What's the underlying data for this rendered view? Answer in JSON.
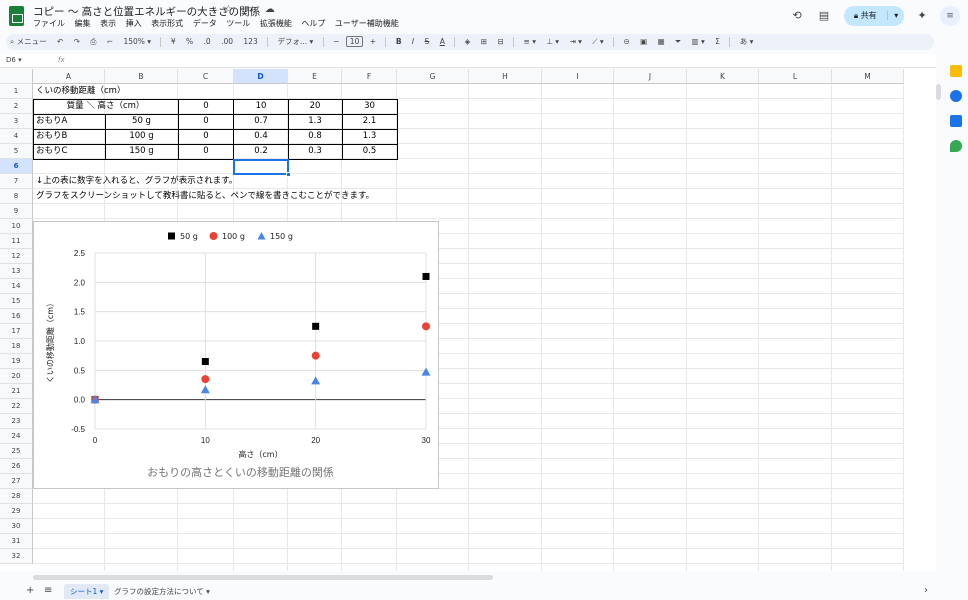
{
  "app": {
    "doc_title": "コピー 〜 高さと位置エネルギーの大きさの関係",
    "title_icons": [
      "star-icon",
      "folder-icon",
      "cloud-icon"
    ],
    "menus": [
      "ファイル",
      "編集",
      "表示",
      "挿入",
      "表示形式",
      "データ",
      "ツール",
      "拡張機能",
      "ヘルプ",
      "ユーザー補助機能"
    ],
    "share_label": "共有",
    "brand_color": "#188038",
    "accent_color": "#1a73e8"
  },
  "toolbar": {
    "menu_search": "メニュー",
    "zoom": "150%",
    "currency": "¥",
    "percent": "%",
    "dec_decrease": ".0",
    "dec_increase": ".00",
    "number_format": "123",
    "font": "デフォ...",
    "font_size": "10",
    "bold": "B",
    "italic": "I",
    "strike": "S",
    "text_color": "A",
    "sum": "Σ",
    "input_method": "あ"
  },
  "formula_bar": {
    "name_box": "D6",
    "fx": "fx",
    "content": ""
  },
  "columns": [
    "A",
    "B",
    "C",
    "D",
    "E",
    "F",
    "G",
    "H",
    "I",
    "J",
    "K",
    "L",
    "M"
  ],
  "selected_column": "D",
  "rows": [
    "1",
    "2",
    "3",
    "4",
    "5",
    "6",
    "7",
    "8",
    "9",
    "10",
    "11",
    "12",
    "13",
    "14",
    "15",
    "16",
    "17",
    "18",
    "19",
    "20",
    "21",
    "22",
    "23",
    "24",
    "25",
    "26",
    "27",
    "28",
    "29",
    "30",
    "31",
    "32"
  ],
  "selected_row": "6",
  "sheet": {
    "a1": "くいの移動距離（cm）",
    "header_label": "質量 ＼ 高さ（cm）",
    "heights": [
      "0",
      "10",
      "20",
      "30"
    ],
    "data_rows": [
      {
        "label": "おもりA",
        "mass": "50 g",
        "values": [
          "0",
          "0.7",
          "1.3",
          "2.1"
        ]
      },
      {
        "label": "おもりB",
        "mass": "100 g",
        "values": [
          "0",
          "0.4",
          "0.8",
          "1.3"
        ]
      },
      {
        "label": "おもりC",
        "mass": "150 g",
        "values": [
          "0",
          "0.2",
          "0.3",
          "0.5"
        ]
      }
    ],
    "note1": "↓上の表に数字を入れると、グラフが表示されます。",
    "note2": "グラフをスクリーンショットして教科書に貼ると、ペンで線を書きこむことができます。"
  },
  "chart_data": {
    "type": "scatter",
    "title": "おもりの高さとくいの移動距離の関係",
    "xlabel": "高さ（cm）",
    "ylabel": "くいの移動距離（cm）",
    "xlim": [
      0,
      30
    ],
    "ylim": [
      -0.5,
      2.5
    ],
    "x_ticks": [
      "0",
      "10",
      "20",
      "30"
    ],
    "y_ticks": [
      "2.5",
      "2.0",
      "1.5",
      "1.0",
      "0.5",
      "0.0",
      "-0.5"
    ],
    "legend_position": "top",
    "grid": true,
    "series": [
      {
        "name": "50 g",
        "marker": "square",
        "color": "#000000",
        "x": [
          0,
          10,
          20,
          30
        ],
        "y": [
          0,
          0.65,
          1.25,
          2.1
        ]
      },
      {
        "name": "100 g",
        "marker": "circle",
        "color": "#ea4335",
        "x": [
          0,
          10,
          20,
          30
        ],
        "y": [
          0,
          0.35,
          0.75,
          1.25
        ]
      },
      {
        "name": "150 g",
        "marker": "triangle",
        "color": "#4a86e8",
        "x": [
          0,
          10,
          20,
          30
        ],
        "y": [
          0,
          0.17,
          0.32,
          0.47
        ]
      }
    ]
  },
  "tabs": {
    "sheets": [
      "シート1",
      "グラフの設定方法について"
    ],
    "active": "シート1"
  }
}
